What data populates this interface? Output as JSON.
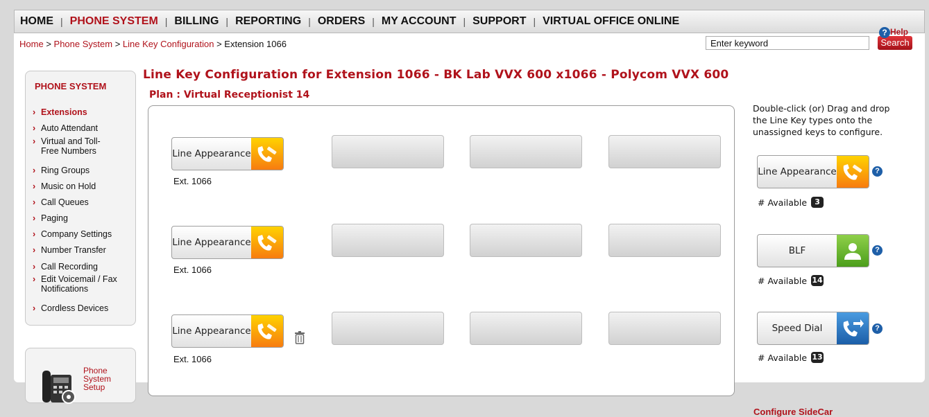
{
  "nav": {
    "items": [
      "HOME",
      "PHONE SYSTEM",
      "BILLING",
      "REPORTING",
      "ORDERS",
      "MY ACCOUNT",
      "SUPPORT",
      "VIRTUAL OFFICE ONLINE"
    ],
    "active": "PHONE SYSTEM",
    "separator": "|"
  },
  "breadcrumb": {
    "home": "Home",
    "sep": ">",
    "phone_system": "Phone System",
    "line_key_config": "Line Key Configuration",
    "current": "Extension 1066"
  },
  "search": {
    "placeholder": "Enter keyword",
    "button": "Search",
    "help": "Help"
  },
  "sidebar": {
    "title": "PHONE SYSTEM",
    "items": [
      {
        "label": "Extensions",
        "active": true
      },
      {
        "label": "Auto Attendant"
      },
      {
        "label": "Virtual and Toll-Free Numbers"
      },
      {
        "label": "Ring Groups"
      },
      {
        "label": "Music on Hold"
      },
      {
        "label": "Call Queues"
      },
      {
        "label": "Paging"
      },
      {
        "label": "Company Settings"
      },
      {
        "label": "Number Transfer"
      },
      {
        "label": "Call Recording"
      },
      {
        "label": "Edit Voicemail / Fax Notifications"
      },
      {
        "label": "Cordless Devices"
      }
    ],
    "setup_link": "Phone System Setup"
  },
  "main": {
    "title": "Line Key Configuration for Extension 1066 - BK Lab VVX 600 x1066 - Polycom VVX 600",
    "plan": "Plan : Virtual Receptionist 14"
  },
  "keys": [
    {
      "label": "Line Appearance",
      "ext": "Ext. 1066",
      "icon": "phone-pencil-icon"
    },
    {
      "label": "Line Appearance",
      "ext": "Ext. 1066",
      "icon": "phone-pencil-icon"
    },
    {
      "label": "Line Appearance",
      "ext": "Ext. 1066",
      "icon": "phone-pencil-icon"
    }
  ],
  "palette": {
    "instructions": "Double-click (or) Drag and drop the Line Key types onto the unassigned keys to configure.",
    "available_label": "# Available",
    "types": [
      {
        "label": "Line Appearance",
        "available": "3",
        "color": "#f7a21b",
        "icon": "phone-pencil-icon"
      },
      {
        "label": "BLF",
        "available": "14",
        "color": "#6bb92e",
        "icon": "person-icon"
      },
      {
        "label": "Speed Dial",
        "available": "13",
        "color": "#2b78c6",
        "icon": "phone-arrow-icon"
      }
    ],
    "configure_sidecar": "Configure SideCar"
  },
  "colors": {
    "brand_red": "#b0121b",
    "help_blue": "#1e5fa8"
  }
}
